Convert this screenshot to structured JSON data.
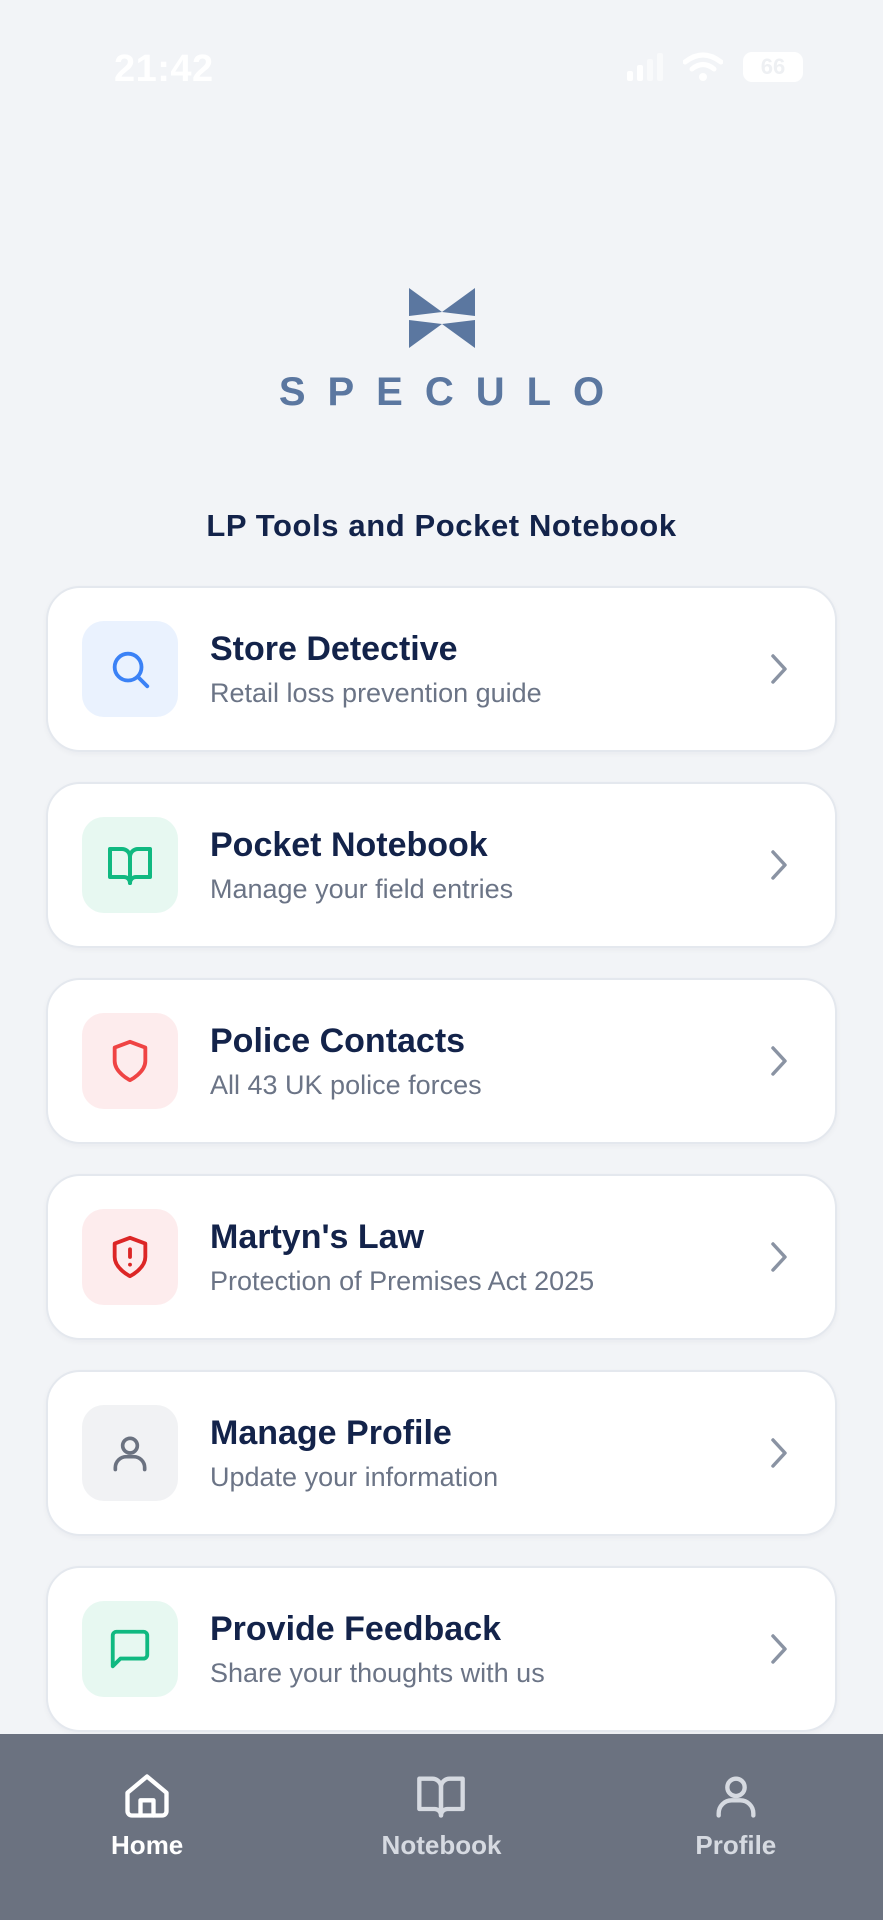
{
  "status_bar": {
    "time": "21:42",
    "battery": "66"
  },
  "brand": {
    "logo_text": "SPECULO"
  },
  "app_subtitle": "LP Tools and Pocket Notebook",
  "menu": {
    "items": [
      {
        "title": "Store Detective",
        "subtitle": "Retail loss prevention guide",
        "icon": "search-icon",
        "icon_color": "#3b82f6",
        "icon_bg": "#eaf2fe"
      },
      {
        "title": "Pocket Notebook",
        "subtitle": "Manage your field entries",
        "icon": "book-open-icon",
        "icon_color": "#10b981",
        "icon_bg": "#e7f8f1"
      },
      {
        "title": "Police Contacts",
        "subtitle": "All 43 UK police forces",
        "icon": "shield-icon",
        "icon_color": "#ef4444",
        "icon_bg": "#fdeced"
      },
      {
        "title": "Martyn's Law",
        "subtitle": "Protection of Premises Act 2025",
        "icon": "shield-alert-icon",
        "icon_color": "#dc2626",
        "icon_bg": "#fdeced"
      },
      {
        "title": "Manage Profile",
        "subtitle": "Update your information",
        "icon": "user-icon",
        "icon_color": "#6b7280",
        "icon_bg": "#f1f2f4"
      },
      {
        "title": "Provide Feedback",
        "subtitle": "Share your thoughts with us",
        "icon": "message-square-icon",
        "icon_color": "#10b981",
        "icon_bg": "#e7f8f1"
      }
    ]
  },
  "bottom_nav": {
    "items": [
      {
        "label": "Home",
        "icon": "home-icon",
        "active": true
      },
      {
        "label": "Notebook",
        "icon": "book-open-icon",
        "active": false
      },
      {
        "label": "Profile",
        "icon": "user-icon",
        "active": false
      }
    ],
    "background": "#6b7280"
  }
}
